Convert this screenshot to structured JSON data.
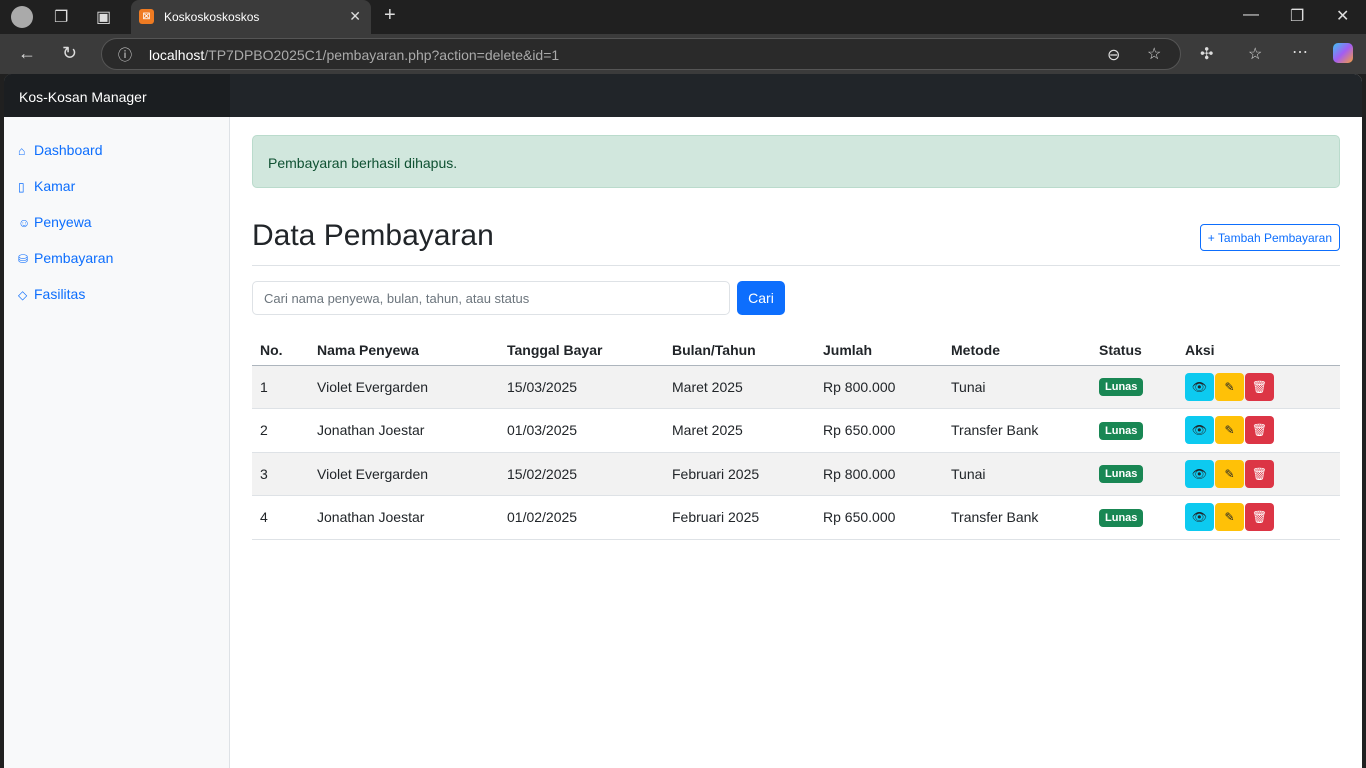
{
  "browser": {
    "tab_title": "Koskoskoskoskos",
    "url_host": "localhost",
    "url_path": "/TP7DPBO2025C1/pembayaran.php?action=delete&id=1"
  },
  "brand": "Kos-Kosan Manager",
  "sidebar": {
    "items": [
      {
        "label": "Dashboard",
        "icon": "⌂"
      },
      {
        "label": "Kamar",
        "icon": "▯"
      },
      {
        "label": "Penyewa",
        "icon": "☺"
      },
      {
        "label": "Pembayaran",
        "icon": "⛁"
      },
      {
        "label": "Fasilitas",
        "icon": "◇"
      }
    ]
  },
  "alert": "Pembayaran berhasil dihapus.",
  "title": "Data Pembayaran",
  "add_button": "+ Tambah Pembayaran",
  "search": {
    "placeholder": "Cari nama penyewa, bulan, tahun, atau status",
    "button": "Cari"
  },
  "table": {
    "headers": [
      "No.",
      "Nama Penyewa",
      "Tanggal Bayar",
      "Bulan/Tahun",
      "Jumlah",
      "Metode",
      "Status",
      "Aksi"
    ],
    "rows": [
      [
        "1",
        "Violet Evergarden",
        "15/03/2025",
        "Maret 2025",
        "Rp 800.000",
        "Tunai",
        "Lunas"
      ],
      [
        "2",
        "Jonathan Joestar",
        "01/03/2025",
        "Maret 2025",
        "Rp 650.000",
        "Transfer Bank",
        "Lunas"
      ],
      [
        "3",
        "Violet Evergarden",
        "15/02/2025",
        "Februari 2025",
        "Rp 800.000",
        "Tunai",
        "Lunas"
      ],
      [
        "4",
        "Jonathan Joestar",
        "01/02/2025",
        "Februari 2025",
        "Rp 650.000",
        "Transfer Bank",
        "Lunas"
      ]
    ]
  },
  "colors": {
    "primary": "#0d6efd",
    "info": "#0dcaf0",
    "warning": "#ffc107",
    "danger": "#dc3545",
    "success": "#198754"
  }
}
